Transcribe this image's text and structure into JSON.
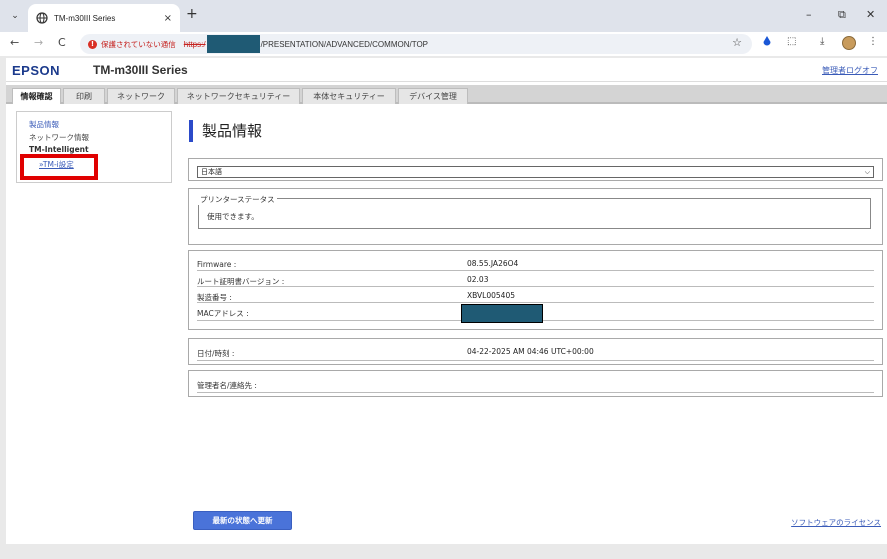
{
  "browser": {
    "tab_title": "TM-m30III Series",
    "tab_close": "×",
    "new_tab": "+",
    "minimize": "–",
    "restore": "⧉",
    "close": "✕",
    "menu_glyph": "⌄",
    "back": "←",
    "forward": "→",
    "reload": "C",
    "security_warning": "保護されていない通信",
    "url_scheme": "https:/",
    "url_path": "/PRESENTATION/ADVANCED/COMMON/TOP",
    "star": "☆",
    "download": "⤓",
    "extensions": "⬚",
    "more": "⋮"
  },
  "header": {
    "brand": "EPSON",
    "model": "TM-m30III Series",
    "logout": "管理者ログオフ"
  },
  "tabs": [
    {
      "label": "情報確認",
      "active": true
    },
    {
      "label": "印刷"
    },
    {
      "label": "ネットワーク"
    },
    {
      "label": "ネットワークセキュリティー"
    },
    {
      "label": "本体セキュリティー"
    },
    {
      "label": "デバイス管理"
    }
  ],
  "sidebar": {
    "items": [
      {
        "label": "製品情報"
      },
      {
        "label": "ネットワーク情報"
      },
      {
        "label": "TM-Intelligent"
      },
      {
        "label": "»TM-i設定"
      }
    ]
  },
  "main": {
    "title": "製品情報",
    "language": "日本語",
    "printer_status_legend": "プリンターステータス",
    "printer_status": "使用できます。",
    "info_rows": [
      {
        "label": "Firmware :",
        "value": "08.55.JA26O4"
      },
      {
        "label": "ルート証明書バージョン :",
        "value": "02.03"
      },
      {
        "label": "製造番号 :",
        "value": "XBVL005405"
      },
      {
        "label": "MACアドレス :",
        "value": ""
      }
    ],
    "datetime_label": "日付/時刻 :",
    "datetime_value": "04-22-2025 AM 04:46 UTC+00:00",
    "admin_label": "管理者名/連絡先 :",
    "admin_value": ""
  },
  "footer": {
    "refresh_button": "最新の状態へ更新",
    "license_link": "ソフトウェアのライセンス"
  },
  "colors": {
    "brand_blue": "#1b3a8c",
    "accent": "#2b4ac9",
    "button": "#4a73d9",
    "highlight_box": "#e00000",
    "redaction": "#1f5a74"
  }
}
